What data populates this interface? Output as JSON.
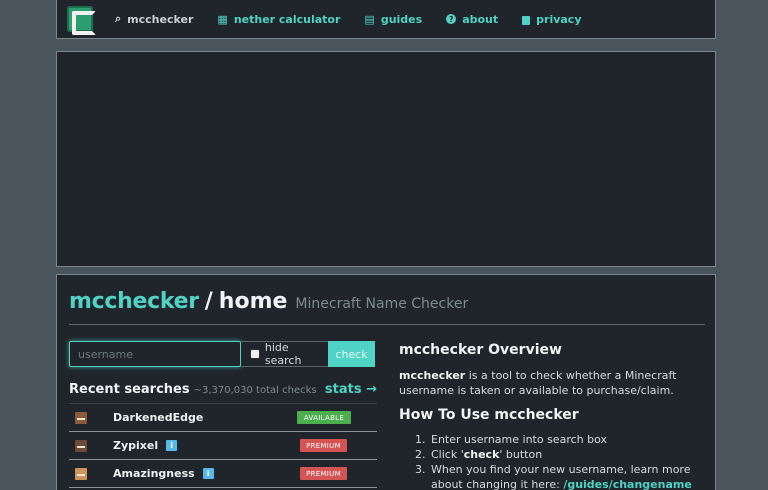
{
  "nav": {
    "items": [
      {
        "label": "mcchecker",
        "icon": "search-icon",
        "glyph": "⌕"
      },
      {
        "label": "nether calculator",
        "icon": "calculator-icon",
        "glyph": "▦"
      },
      {
        "label": "guides",
        "icon": "book-icon",
        "glyph": "▤"
      },
      {
        "label": "about",
        "icon": "question-circle-icon",
        "glyph": "?"
      },
      {
        "label": "privacy",
        "icon": "lock-icon",
        "glyph": "🔒"
      }
    ]
  },
  "header": {
    "brand": "mcchecker",
    "separator": "/",
    "page": "home",
    "subtitle": "Minecraft Name Checker"
  },
  "search": {
    "placeholder": "username",
    "value": "",
    "hide_label": "hide search",
    "hide_checked": false,
    "button_label": "check"
  },
  "recent": {
    "title": "Recent searches",
    "total": "~3,370,030 total checks",
    "stats_link": "stats →",
    "rows": [
      {
        "name": "DarkenedEdge",
        "info": false,
        "status": "AVAILABLE",
        "skin_color": "#8a5a3c"
      },
      {
        "name": "Zypixel",
        "info": true,
        "info_label": "i",
        "status": "PREMIUM",
        "skin_color": "#6b4a3a"
      },
      {
        "name": "Amazingness",
        "info": true,
        "info_label": "i",
        "status": "PREMIUM",
        "skin_color": "#c8955d"
      }
    ]
  },
  "overview": {
    "title": "mcchecker Overview",
    "text_bold": "mcchecker",
    "text_rest": " is a tool to check whether a Minecraft username is taken or available to purchase/claim.",
    "howto_title": "How To Use mcchecker",
    "step1": "Enter username into search box",
    "step2_pre": "Click '",
    "step2_bold": "check",
    "step2_post": "' button",
    "step3_text": "When you find your new username, learn more about changing it here: ",
    "step3_link": "/guides/changename"
  },
  "colors": {
    "accent": "#4fd3c4",
    "available": "#4cae4c",
    "premium": "#d45353",
    "panel": "#1f252b",
    "background": "#4a545d"
  }
}
